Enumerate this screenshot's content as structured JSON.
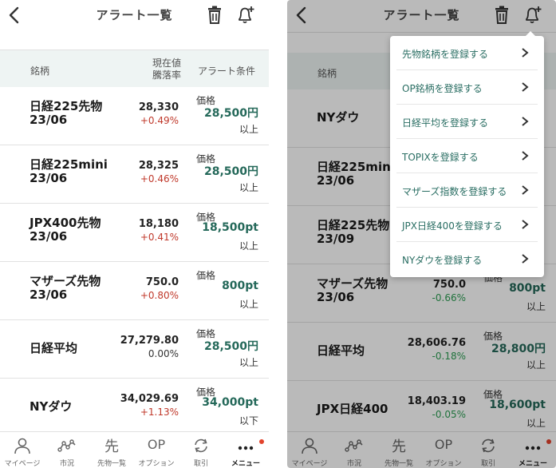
{
  "left": {
    "header": {
      "title": "アラート一覧"
    },
    "columns": {
      "name": "銘柄",
      "price_line1": "現在値",
      "price_line2": "騰落率",
      "condition": "アラート条件"
    },
    "rows": [
      {
        "name_line1": "日経225先物",
        "name_line2": "23/06",
        "price": "28,330",
        "change": "+0.49%",
        "dir_class": "up",
        "label": "価格",
        "target": "28,500円",
        "direction": "以上"
      },
      {
        "name_line1": "日経225mini",
        "name_line2": "23/06",
        "price": "28,325",
        "change": "+0.46%",
        "dir_class": "up",
        "label": "価格",
        "target": "28,500円",
        "direction": "以上"
      },
      {
        "name_line1": "JPX400先物",
        "name_line2": "23/06",
        "price": "18,180",
        "change": "+0.41%",
        "dir_class": "up",
        "label": "価格",
        "target": "18,500pt",
        "direction": "以上"
      },
      {
        "name_line1": "マザーズ先物",
        "name_line2": "23/06",
        "price": "750.0",
        "change": "+0.80%",
        "dir_class": "up",
        "label": "価格",
        "target": "800pt",
        "direction": "以上"
      },
      {
        "name_line1": "日経平均",
        "name_line2": "",
        "price": "27,279.80",
        "change": "0.00%",
        "dir_class": "zero",
        "label": "価格",
        "target": "28,500円",
        "direction": "以上"
      },
      {
        "name_line1": "NYダウ",
        "name_line2": "",
        "price": "34,029.69",
        "change": "+1.13%",
        "dir_class": "up",
        "label": "価格",
        "target": "34,000pt",
        "direction": "以下"
      }
    ]
  },
  "right": {
    "header": {
      "title": "アラート一覧"
    },
    "columns": {
      "name": "銘柄"
    },
    "rows": [
      {
        "name_line1": "NYダウ",
        "name_line2": "",
        "price": "",
        "change": "",
        "dir_class": "up",
        "label": "",
        "target": "",
        "direction": ""
      },
      {
        "name_line1": "日経225mini",
        "name_line2": "23/06",
        "price": "",
        "change": "",
        "dir_class": "up",
        "label": "",
        "target": "",
        "direction": ""
      },
      {
        "name_line1": "日経225先物",
        "name_line2": "23/09",
        "price": "",
        "change": "",
        "dir_class": "up",
        "label": "",
        "target": "",
        "direction": ""
      },
      {
        "name_line1": "マザーズ先物",
        "name_line2": "23/06",
        "price": "750.0",
        "change": "-0.66%",
        "dir_class": "down",
        "label": "価格",
        "target": "800pt",
        "direction": "以上"
      },
      {
        "name_line1": "日経平均",
        "name_line2": "",
        "price": "28,606.76",
        "change": "-0.18%",
        "dir_class": "down",
        "label": "価格",
        "target": "28,800円",
        "direction": "以上"
      },
      {
        "name_line1": "JPX日経400",
        "name_line2": "",
        "price": "18,403.19",
        "change": "-0.05%",
        "dir_class": "down",
        "label": "価格",
        "target": "18,600pt",
        "direction": "以上"
      }
    ],
    "menu": [
      "先物銘柄を登録する",
      "OP銘柄を登録する",
      "日経平均を登録する",
      "TOPIXを登録する",
      "マザーズ指数を登録する",
      "JPX日経400を登録する",
      "NYダウを登録する"
    ]
  },
  "tabbar": [
    {
      "label": "マイページ",
      "icon": "person-icon"
    },
    {
      "label": "市況",
      "icon": "market-line-icon"
    },
    {
      "label": "先物一覧",
      "icon": "saki-glyph",
      "glyph": "先"
    },
    {
      "label": "オプション",
      "icon": "op-glyph",
      "glyph": "OP"
    },
    {
      "label": "取引",
      "icon": "refresh-cycle-icon"
    },
    {
      "label": "メニュー",
      "icon": "more-dots-icon",
      "active": true
    }
  ],
  "colors": {
    "accent_green": "#25695a",
    "up_red": "#c0392b",
    "down_green": "#2e9e54",
    "header_bg": "#eef4f3",
    "badge_red": "#e2432c"
  }
}
